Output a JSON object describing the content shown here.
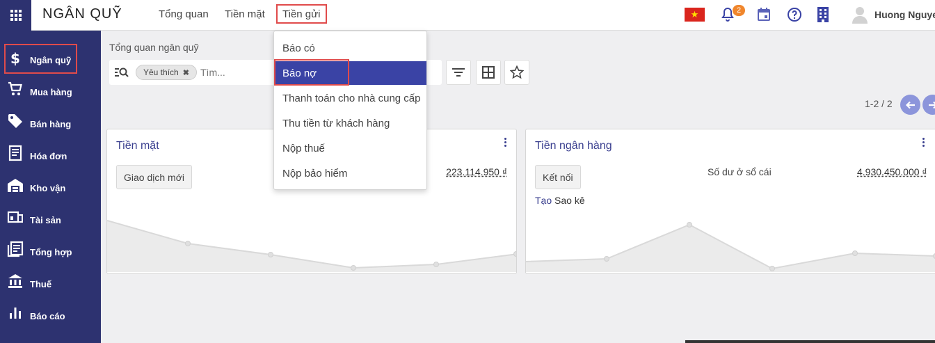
{
  "app": {
    "title": "NGÂN QUỸ",
    "menus": [
      "Tổng quan",
      "Tiền mặt",
      "Tiền gửi"
    ],
    "notification_count": "2",
    "user_name": "Huong Nguyen",
    "flag_glyph": "★"
  },
  "sidebar": {
    "items": [
      {
        "label": "Ngân quỹ",
        "icon": "dollar-icon"
      },
      {
        "label": "Mua hàng",
        "icon": "cart-icon"
      },
      {
        "label": "Bán hàng",
        "icon": "tag-icon"
      },
      {
        "label": "Hóa đơn",
        "icon": "invoice-icon"
      },
      {
        "label": "Kho vận",
        "icon": "warehouse-icon"
      },
      {
        "label": "Tài sản",
        "icon": "asset-icon"
      },
      {
        "label": "Tổng hợp",
        "icon": "ledger-icon"
      },
      {
        "label": "Thuế",
        "icon": "bank-icon"
      },
      {
        "label": "Báo cáo",
        "icon": "chart-icon"
      }
    ]
  },
  "control": {
    "breadcrumb": "Tổng quan ngân quỹ",
    "facet": "Yêu thích",
    "search_placeholder": "Tìm...",
    "pager": "1-2 / 2"
  },
  "dropdown": {
    "items": [
      "Báo có",
      "Báo nợ",
      "Thanh toán cho nhà cung cấp",
      "Thu tiền từ khách hàng",
      "Nộp thuế",
      "Nộp bảo hiểm"
    ],
    "active_index": 1
  },
  "cards": {
    "cash": {
      "title": "Tiền mặt",
      "button": "Giao dịch mới",
      "amount": "223.114.950 ₫"
    },
    "bank": {
      "title": "Tiền ngân hàng",
      "button": "Kết nối",
      "balance_label": "Số dư ở sổ cái",
      "amount": "4.930.450.000 ₫",
      "statement_link": "Tạo",
      "statement_text": " Sao kê"
    }
  },
  "colors": {
    "sidebar": "#2d3270",
    "accent": "#3a43a5",
    "highlight_border": "#e04b4b",
    "badge": "#f0862c"
  }
}
